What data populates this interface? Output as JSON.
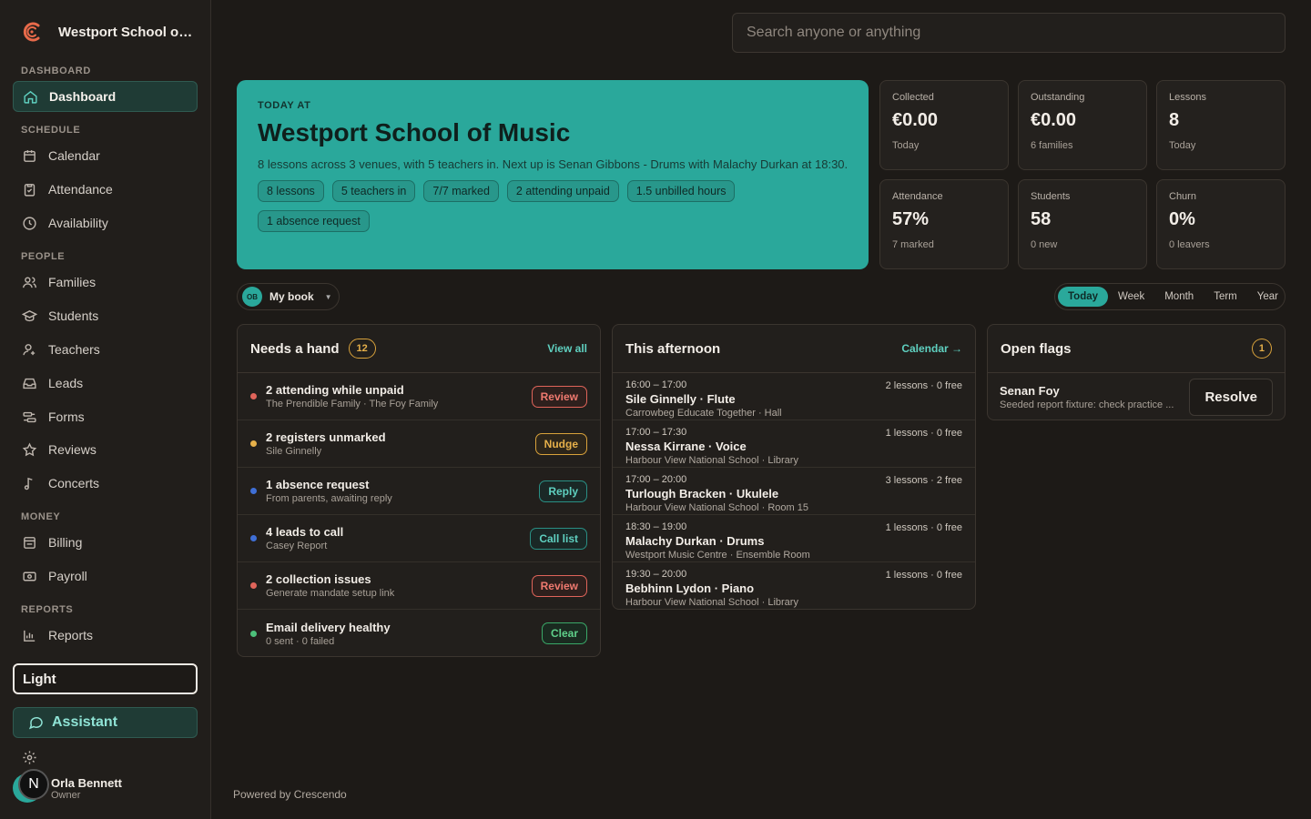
{
  "sidebar": {
    "brand_name": "Westport School of Music",
    "sections": {
      "dashboard": "DASHBOARD",
      "schedule": "SCHEDULE",
      "people": "PEOPLE",
      "money": "MONEY",
      "reports": "REPORTS"
    },
    "items": {
      "dashboard": "Dashboard",
      "calendar": "Calendar",
      "attendance": "Attendance",
      "availability": "Availability",
      "families": "Families",
      "students": "Students",
      "teachers": "Teachers",
      "leads": "Leads",
      "forms": "Forms",
      "reviews": "Reviews",
      "concerts": "Concerts",
      "billing": "Billing",
      "payroll": "Payroll",
      "reports": "Reports"
    },
    "theme_toggle": "Light",
    "assistant": "Assistant",
    "settings": "Settings",
    "user": {
      "name": "Orla Bennett",
      "role": "Owner",
      "badge": "N"
    }
  },
  "search": {
    "placeholder": "Search anyone or anything"
  },
  "hero": {
    "kicker": "TODAY AT",
    "title": "Westport School of Music",
    "description": "8 lessons across 3 venues, with 5 teachers in. Next up is Senan Gibbons - Drums with Malachy Durkan at 18:30.",
    "chips": [
      "8 lessons",
      "5 teachers in",
      "7/7 marked",
      "2 attending unpaid",
      "1.5 unbilled hours",
      "1 absence request"
    ]
  },
  "stats": [
    {
      "label": "Collected",
      "value": "€0.00",
      "sub": "Today"
    },
    {
      "label": "Outstanding",
      "value": "€0.00",
      "sub": "6 families"
    },
    {
      "label": "Lessons",
      "value": "8",
      "sub": "Today"
    },
    {
      "label": "Attendance",
      "value": "57%",
      "sub": "7 marked"
    },
    {
      "label": "Students",
      "value": "58",
      "sub": "0 new"
    },
    {
      "label": "Churn",
      "value": "0%",
      "sub": "0 leavers"
    }
  ],
  "book": {
    "initials": "OB",
    "label": "My book"
  },
  "range": {
    "today": "Today",
    "week": "Week",
    "month": "Month",
    "term": "Term",
    "year": "Year",
    "selected": "Today"
  },
  "needs": {
    "title": "Needs a hand",
    "count": "12",
    "link": "View all",
    "rows": [
      {
        "title": "2 attending while unpaid",
        "sub": "The Prendible Family · The Foy Family",
        "action": "Review",
        "color": "#e0645a"
      },
      {
        "title": "2 registers unmarked",
        "sub": "Sile Ginnelly",
        "action": "Nudge",
        "color": "#e6b04a"
      },
      {
        "title": "1 absence request",
        "sub": "From parents, awaiting reply",
        "action": "Reply",
        "color": "#3f6fd6"
      },
      {
        "title": "4 leads to call",
        "sub": "Casey Report",
        "action": "Call list",
        "color": "#3f6fd6"
      },
      {
        "title": "2 collection issues",
        "sub": "Generate mandate setup link",
        "action": "Review",
        "color": "#e0645a"
      },
      {
        "title": "Email delivery healthy",
        "sub": "0 sent · 0 failed",
        "action": "Clear",
        "color": "#4cc07a"
      }
    ]
  },
  "afternoon": {
    "title": "This afternoon",
    "link": "Calendar →",
    "slots": [
      {
        "time": "16:00 – 17:00",
        "who": "Sile Ginnelly · Flute",
        "where": "Carrowbeg Educate Together · Hall",
        "meta": "2 lessons · 0 free"
      },
      {
        "time": "17:00 – 17:30",
        "who": "Nessa Kirrane · Voice",
        "where": "Harbour View National School · Library",
        "meta": "1 lessons · 0 free"
      },
      {
        "time": "17:00 – 20:00",
        "who": "Turlough Bracken · Ukulele",
        "where": "Harbour View National School · Room 15",
        "meta": "3 lessons · 2 free"
      },
      {
        "time": "18:30 – 19:00",
        "who": "Malachy Durkan · Drums",
        "where": "Westport Music Centre · Ensemble Room",
        "meta": "1 lessons · 0 free"
      },
      {
        "time": "19:30 – 20:00",
        "who": "Bebhinn Lydon · Piano",
        "where": "Harbour View National School · Library",
        "meta": "1 lessons · 0 free"
      }
    ]
  },
  "flags": {
    "title": "Open flags",
    "count": "1",
    "items": [
      {
        "name": "Senan Foy",
        "desc": "Seeded report fixture: check practice ...",
        "action": "Resolve"
      }
    ]
  },
  "footer": {
    "powered": "Powered by Crescendo"
  },
  "colors": {
    "accent": "#2aa89b",
    "background": "#1d1a17",
    "sidebar": "#211e1b"
  }
}
